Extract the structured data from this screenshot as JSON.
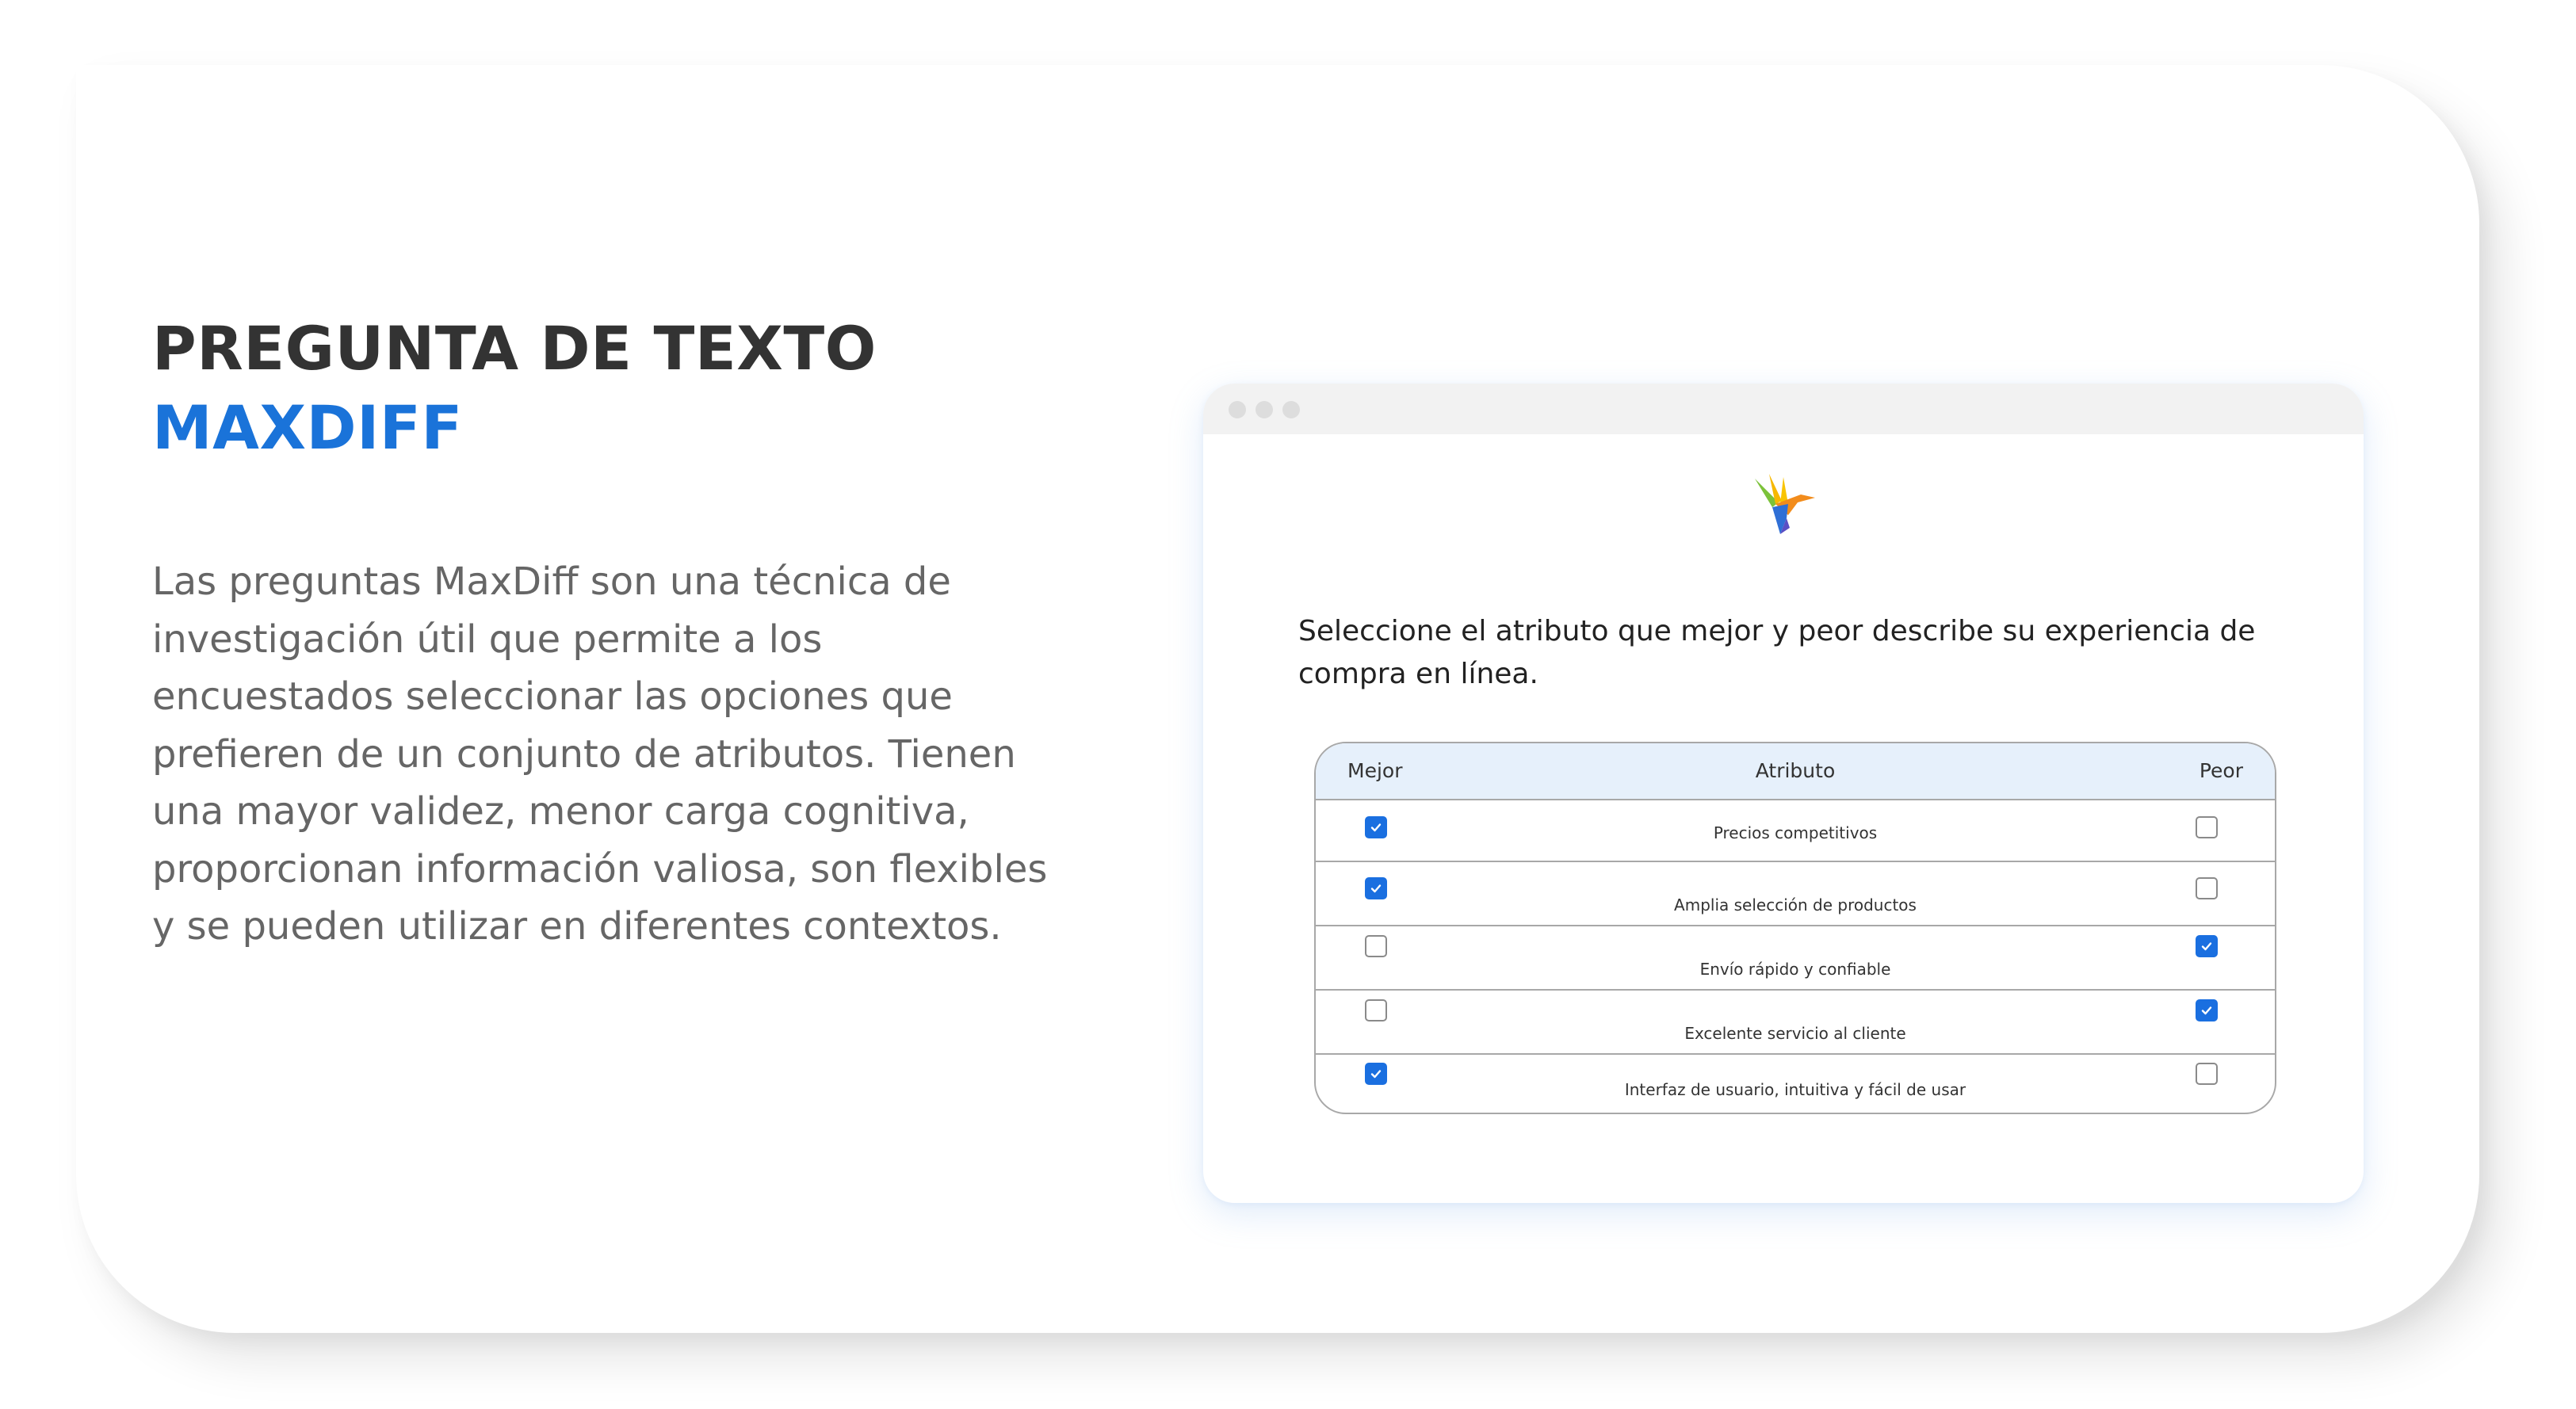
{
  "heading": {
    "line1": "PREGUNTA DE TEXTO",
    "line2": "MAXDIFF"
  },
  "description": "Las preguntas MaxDiff son una técnica de investigación útil que permite a los encuestados seleccionar las opciones que prefieren de un conjunto de atributos. Tienen una mayor validez, menor carga cognitiva, proporcionan información valiosa, son flexibles y se pueden utilizar en diferentes contextos.",
  "colors": {
    "accent": "#1a73d9",
    "checkbox": "#1a6fe0",
    "header_bg": "#e6f0fb"
  },
  "survey": {
    "logo": "hummingbird-logo-icon",
    "question": "Seleccione el atributo que mejor y peor describe su experiencia de compra en línea.",
    "columns": {
      "best": "Mejor",
      "attribute": "Atributo",
      "worst": "Peor"
    },
    "rows": [
      {
        "attribute": "Precios competitivos",
        "best": true,
        "worst": false
      },
      {
        "attribute": "Amplia selección de productos",
        "best": true,
        "worst": false
      },
      {
        "attribute": "Envío rápido y confiable",
        "best": false,
        "worst": true
      },
      {
        "attribute": "Excelente servicio al cliente",
        "best": false,
        "worst": true
      },
      {
        "attribute": "Interfaz de usuario, intuitiva y fácil de usar",
        "best": true,
        "worst": false
      }
    ]
  }
}
